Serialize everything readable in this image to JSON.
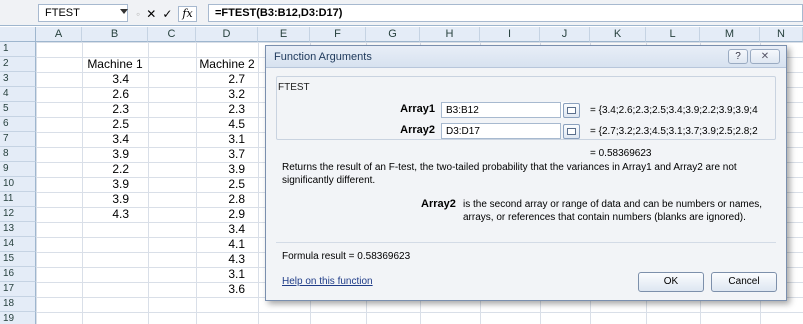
{
  "formula_bar": {
    "name_box": "FTEST",
    "cancel_glyph": "✕",
    "enter_glyph": "✓",
    "fx_label": "fx",
    "formula": "=FTEST(B3:B12,D3:D17)"
  },
  "columns": [
    "A",
    "B",
    "C",
    "D",
    "E",
    "F",
    "G",
    "H",
    "I",
    "J",
    "K",
    "L",
    "M",
    "N"
  ],
  "rows": [
    "1",
    "2",
    "3",
    "4",
    "5",
    "6",
    "7",
    "8",
    "9",
    "10",
    "11",
    "12",
    "13",
    "14",
    "15",
    "16",
    "17",
    "18",
    "19"
  ],
  "sheet": {
    "machine1_header": "Machine 1",
    "machine2_header": "Machine 2",
    "machine1": [
      "3.4",
      "2.6",
      "2.3",
      "2.5",
      "3.4",
      "3.9",
      "2.2",
      "3.9",
      "3.9",
      "4.3"
    ],
    "machine2": [
      "2.7",
      "3.2",
      "2.3",
      "4.5",
      "3.1",
      "3.7",
      "3.9",
      "2.5",
      "2.8",
      "2.9",
      "3.4",
      "4.1",
      "4.3",
      "3.1",
      "3.6"
    ]
  },
  "dialog": {
    "title": "Function Arguments",
    "help_button": "?",
    "close_button": "✕",
    "function_name": "FTEST",
    "array1_label": "Array1",
    "array1_value": "B3:B12",
    "array1_result": "=  {3.4;2.6;2.3;2.5;3.4;3.9;2.2;3.9;3.9;4",
    "array2_label": "Array2",
    "array2_value": "D3:D17",
    "array2_result": "=  {2.7;3.2;2.3;4.5;3.1;3.7;3.9;2.5;2.8;2",
    "result_line": "=  0.58369623",
    "description": "Returns the result of an F-test, the two-tailed probability that the variances in Array1 and Array2 are not significantly different.",
    "arg_desc_label": "Array2",
    "arg_desc": "is the second array or range of data and can be numbers or names, arrays, or references that contain numbers (blanks are ignored).",
    "formula_result": "Formula result =  0.58369623",
    "help_link": "Help on this function",
    "ok_button": "OK",
    "cancel_button": "Cancel"
  }
}
